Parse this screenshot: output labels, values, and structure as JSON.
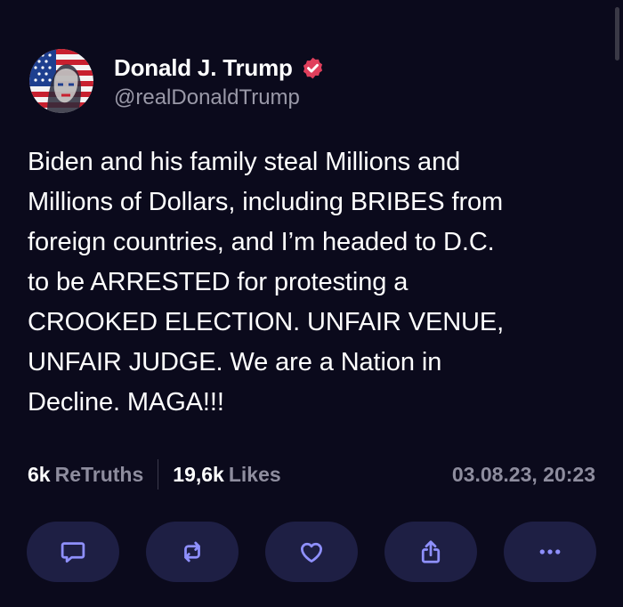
{
  "post": {
    "author": {
      "display_name": "Donald J. Trump",
      "handle": "@realDonaldTrump",
      "verified": true,
      "avatar_icon": "flag-portrait-avatar"
    },
    "text": "Biden and his family steal Millions and\nMillions of Dollars, including BRIBES from\nforeign countries, and I’m headed to D.C.\nto be ARRESTED for protesting a\nCROOKED ELECTION. UNFAIR VENUE,\nUNFAIR JUDGE. We are a Nation in\nDecline. MAGA!!!",
    "stats": {
      "retruths_count": "6k",
      "retruths_label": "ReTruths",
      "likes_count": "19,6k",
      "likes_label": "Likes"
    },
    "timestamp": "03.08.23, 20:23"
  },
  "actions": [
    {
      "name": "reply",
      "icon": "comment-icon"
    },
    {
      "name": "retruth",
      "icon": "repost-icon"
    },
    {
      "name": "like",
      "icon": "heart-icon"
    },
    {
      "name": "share",
      "icon": "share-icon"
    },
    {
      "name": "more",
      "icon": "more-icon"
    }
  ],
  "colors": {
    "background": "#0b0a1c",
    "button_bg": "#1e1f44",
    "icon_accent": "#8f90ff",
    "verified_badge": "#e03f5c",
    "secondary_text": "#8e8d9e"
  }
}
